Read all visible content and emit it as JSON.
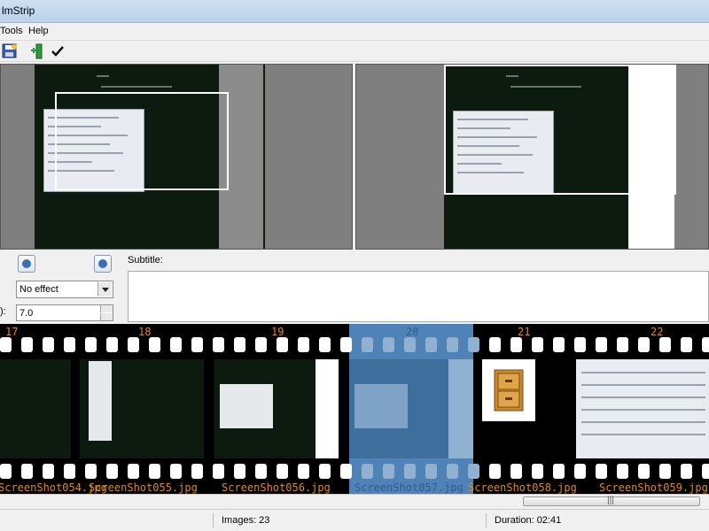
{
  "window": {
    "title": "lmStrip"
  },
  "menu": {
    "tools": "Tools",
    "help": "Help"
  },
  "controls": {
    "effect_value": "No effect",
    "duration_label": "):",
    "duration_value": "7.0",
    "subtitle_label": "Subtitle:"
  },
  "filmstrip": {
    "frames": [
      {
        "num": "17",
        "name": "ScreenShot054.jpg"
      },
      {
        "num": "18",
        "name": "ScreenShot055.jpg"
      },
      {
        "num": "19",
        "name": "ScreenShot056.jpg"
      },
      {
        "num": "20",
        "name": "ScreenShot057.jpg"
      },
      {
        "num": "21",
        "name": "ScreenShot058.jpg"
      },
      {
        "num": "22",
        "name": "ScreenShot059.jpg"
      }
    ],
    "selected_index": 3
  },
  "scrollbar": {
    "grip": "|||"
  },
  "status": {
    "images": "Images: 23",
    "duration": "Duration: 02:41"
  },
  "colors": {
    "accent": "#4f83b8",
    "frame_label": "#d8892a"
  }
}
